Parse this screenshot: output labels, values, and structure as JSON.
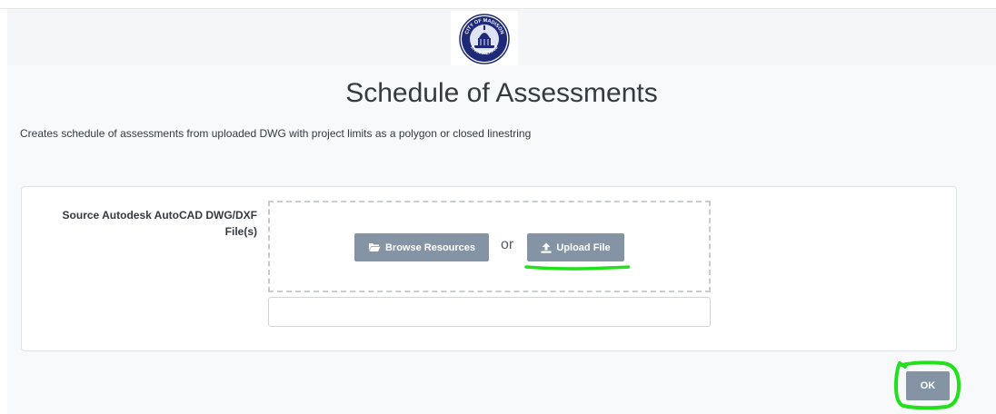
{
  "page": {
    "title": "Schedule of Assessments",
    "description": "Creates schedule of assessments from uploaded DWG with project limits as a polygon or closed linestring"
  },
  "logo": {
    "text_top": "CITY OF MADISON",
    "text_bottom": "ENGINEERING"
  },
  "form": {
    "source_label": "Source Autodesk AutoCAD DWG/DXF File(s)",
    "browse_label": "Browse Resources",
    "browse_icon": "folder-open-icon",
    "or_text": "or",
    "upload_label": "Upload File",
    "upload_icon": "upload-icon",
    "file_input_value": ""
  },
  "actions": {
    "ok_label": "OK"
  },
  "colors": {
    "button": "#8594a4",
    "highlight": "#22e01c"
  }
}
